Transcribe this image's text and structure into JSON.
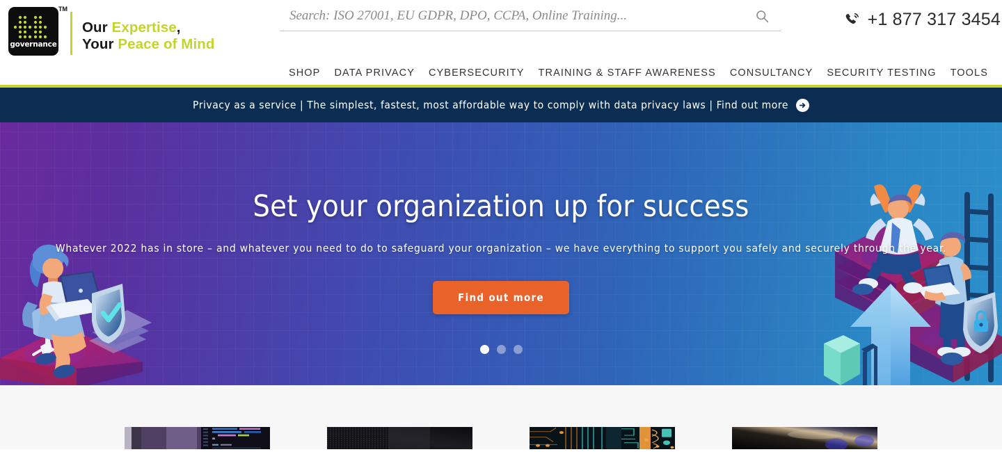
{
  "brand": {
    "logo_icon": "itgovernance-dot-matrix-logo",
    "logo_word": "governance",
    "trademark": "TM",
    "tagline_line1_plain": "Our ",
    "tagline_line1_hl": "Expertise",
    "tagline_line1_tail": ",",
    "tagline_line2_plain": "Your ",
    "tagline_line2_hl": "Peace of Mind",
    "accent_color": "#c4d52a"
  },
  "search": {
    "placeholder": "Search: ISO 27001, EU GDPR, DPO, CCPA, Online Training...",
    "value": "",
    "icon": "search-icon"
  },
  "contact": {
    "phone": "+1 877 317 3454",
    "icon": "phone-ring-icon"
  },
  "nav": {
    "items": [
      {
        "label": "SHOP"
      },
      {
        "label": "DATA PRIVACY"
      },
      {
        "label": "CYBERSECURITY"
      },
      {
        "label": "TRAINING & STAFF AWARENESS"
      },
      {
        "label": "CONSULTANCY"
      },
      {
        "label": "SECURITY TESTING"
      },
      {
        "label": "TOOLS"
      }
    ]
  },
  "banner": {
    "text": "Privacy as a service | The simplest, fastest, most affordable way to comply with data privacy laws | Find out more",
    "arrow_icon": "arrow-right-circle-icon",
    "background": "#0b2d52",
    "rule_color": "#c4d52a"
  },
  "hero": {
    "title": "Set your organization up for success",
    "subtitle": "Whatever 2022 has in store – and whatever you need to do to safeguard your organization – we have everything to support you safely and securely through the year.",
    "cta_label": "Find out more",
    "cta_color": "#e8622a",
    "gradient_from": "#6a2a9e",
    "gradient_to": "#2b90cb",
    "slides": [
      {
        "active": true
      },
      {
        "active": false
      },
      {
        "active": false
      }
    ],
    "art_left": "woman-on-chair-with-laptop-and-shield-illustration",
    "art_right": "two-people-on-stacked-platforms-with-ladder-arrow-and-lock-shield-illustration"
  },
  "cards": {
    "items": [
      {
        "thumb": "code-editor-screenshot"
      },
      {
        "thumb": "dark-mesh-texture"
      },
      {
        "thumb": "circuit-board-closeup"
      },
      {
        "thumb": "dark-blurred-light-streak"
      }
    ]
  }
}
